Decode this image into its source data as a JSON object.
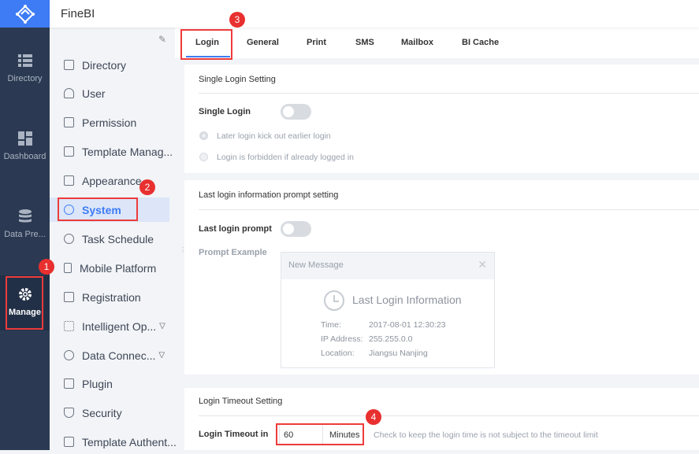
{
  "app": {
    "title": "FineBI"
  },
  "rail": [
    {
      "label": "Directory"
    },
    {
      "label": "Dashboard"
    },
    {
      "label": "Data Pre..."
    },
    {
      "label": "Manage"
    }
  ],
  "sidebar": [
    {
      "label": "Directory"
    },
    {
      "label": "User"
    },
    {
      "label": "Permission"
    },
    {
      "label": "Template Manag..."
    },
    {
      "label": "Appearance"
    },
    {
      "label": "System"
    },
    {
      "label": "Task Schedule"
    },
    {
      "label": "Mobile Platform"
    },
    {
      "label": "Registration"
    },
    {
      "label": "Intelligent Op..."
    },
    {
      "label": "Data Connec..."
    },
    {
      "label": "Plugin"
    },
    {
      "label": "Security"
    },
    {
      "label": "Template Authent..."
    }
  ],
  "tabs": [
    "Login",
    "General",
    "Print",
    "SMS",
    "Mailbox",
    "BI Cache"
  ],
  "single": {
    "title": "Single Login Setting",
    "label": "Single Login",
    "opt1": "Later login kick out earlier login",
    "opt2": "Login is forbidden if already logged in"
  },
  "last": {
    "title": "Last login information prompt setting",
    "label": "Last login prompt",
    "example": "Prompt Example",
    "msg_title": "New Message",
    "info_title": "Last Login Information",
    "time_k": "Time:",
    "time_v": "2017-08-01 12:30:23",
    "ip_k": "IP Address:",
    "ip_v": "255.255.0.0",
    "loc_k": "Location:",
    "loc_v": "Jiangsu Nanjing"
  },
  "timeout": {
    "title": "Login Timeout Setting",
    "label": "Login Timeout in",
    "value": "60",
    "unit": "Minutes",
    "hint": "Check to keep the login time is not subject to the timeout limit"
  },
  "badges": [
    "1",
    "2",
    "3",
    "4"
  ]
}
